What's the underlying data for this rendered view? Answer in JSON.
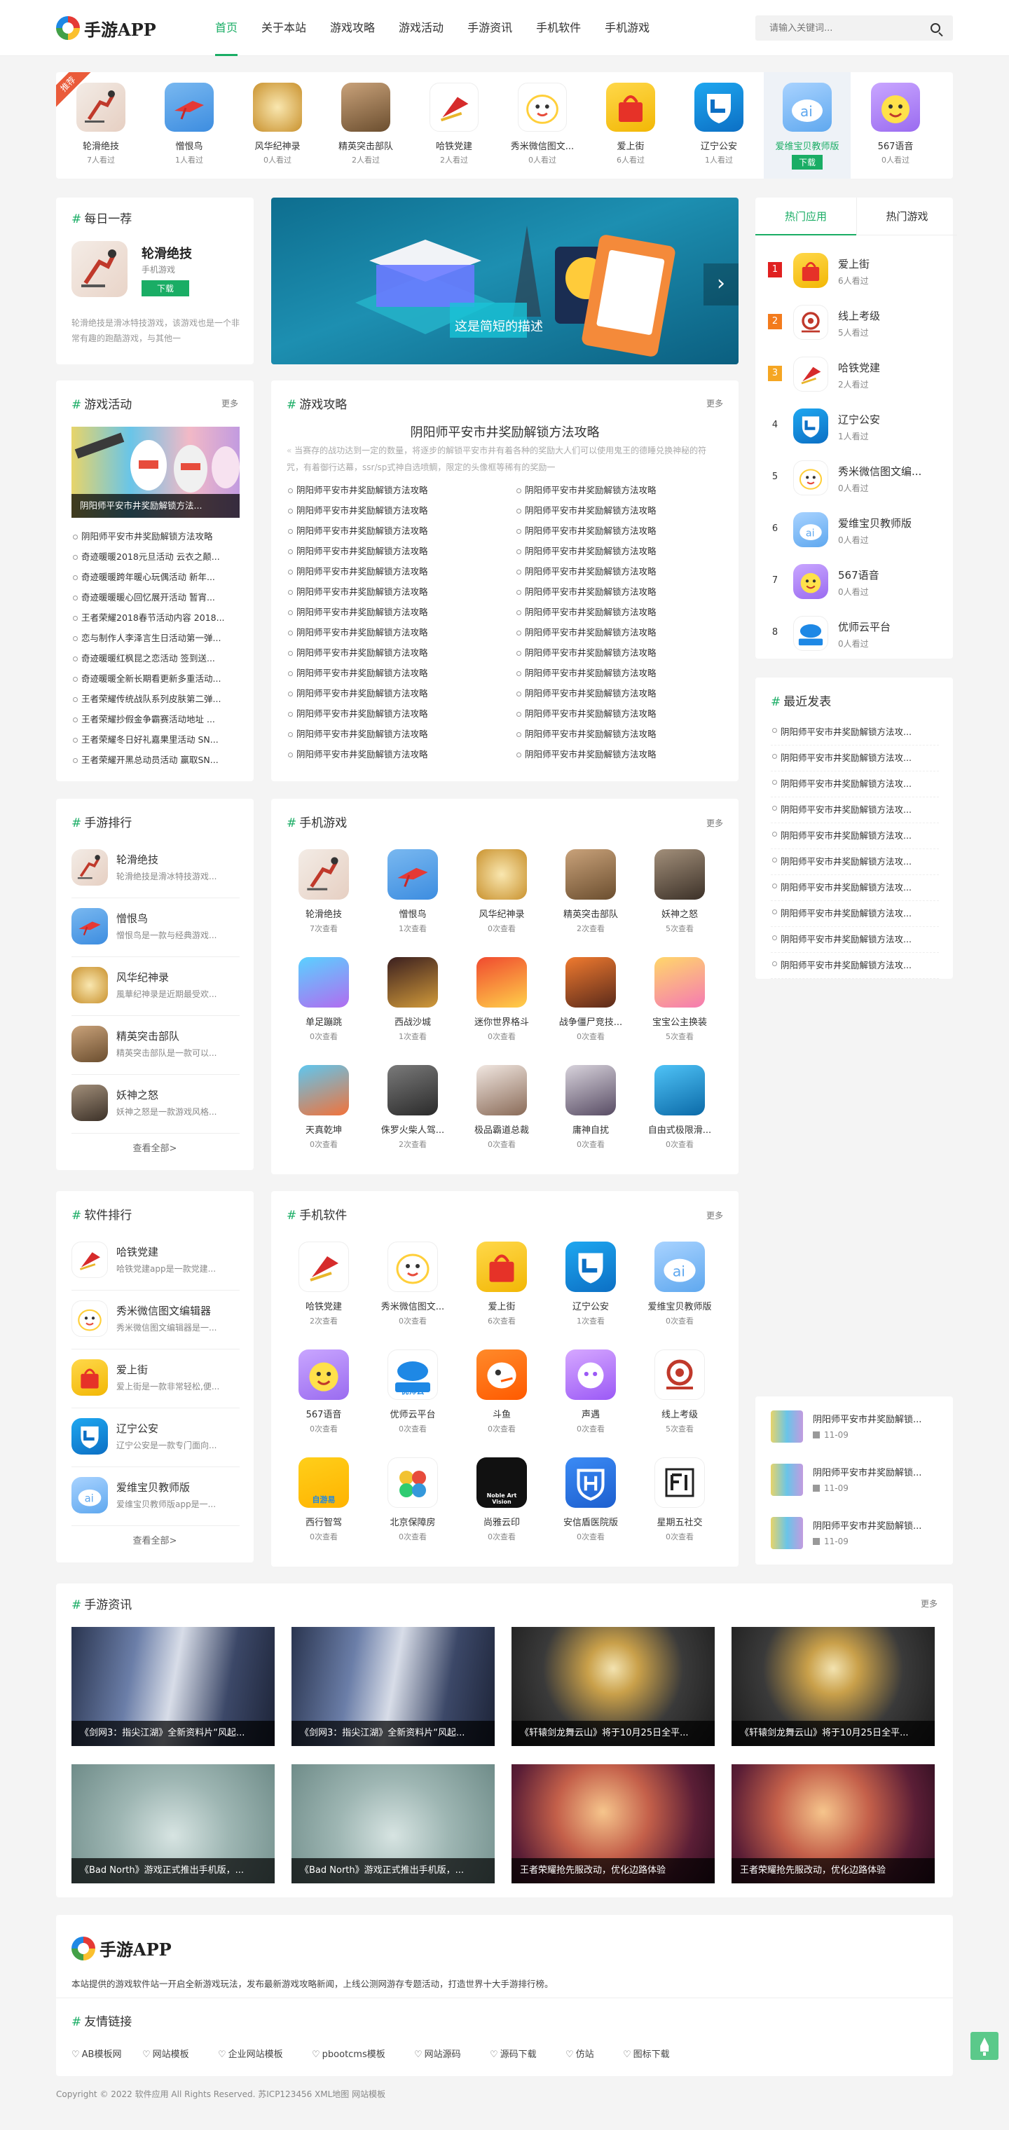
{
  "header": {
    "logo_text": "手游APP",
    "nav": [
      "首页",
      "关于本站",
      "游戏攻略",
      "游戏活动",
      "手游资讯",
      "手机软件",
      "手机游戏"
    ],
    "search_placeholder": "请输入关键词..."
  },
  "hot_strip": {
    "badge": "推荐",
    "items": [
      {
        "name": "轮滑绝技",
        "views": "7人看过",
        "icon": "skater-icon"
      },
      {
        "name": "憎恨鸟",
        "views": "1人看过",
        "icon": "bird-icon"
      },
      {
        "name": "风华纪神录",
        "views": "0人看过",
        "icon": "shenlu-icon"
      },
      {
        "name": "精英突击部队",
        "views": "2人看过",
        "icon": "soldier-icon"
      },
      {
        "name": "哈铁党建",
        "views": "2人看过",
        "icon": "party-flag-icon"
      },
      {
        "name": "秀米微信图文...",
        "views": "0人看过",
        "icon": "xiumi-icon"
      },
      {
        "name": "爱上街",
        "views": "6人看过",
        "icon": "shop-bag-icon"
      },
      {
        "name": "辽宁公安",
        "views": "1人看过",
        "icon": "police-icon"
      },
      {
        "name": "爱维宝贝教师版",
        "views": "",
        "icon": "ai-cloud-icon",
        "download": "下载"
      },
      {
        "name": "567语音",
        "views": "0人看过",
        "icon": "voice-face-icon"
      }
    ]
  },
  "daily": {
    "title": "每日一荐",
    "name": "轮滑绝技",
    "category": "手机游戏",
    "download": "下载",
    "desc": "轮滑绝技是滑冰特技游戏，该游戏也是一个非常有趣的跑酷游戏，与其他一"
  },
  "banner": {
    "caption": "这是简短的描述"
  },
  "activities": {
    "title": "游戏活动",
    "more": "更多",
    "image_caption": "阴阳师平安市井奖励解锁方法...",
    "items": [
      "阴阳师平安市井奖励解锁方法攻略",
      "奇迹暖暖2018元旦活动 云衣之颠...",
      "奇迹暖暖跨年暖心玩偶活动 新年...",
      "奇迹暖暖暖心回忆展开活动 暂宵...",
      "王者荣耀2018春节活动内容 2018...",
      "恋与制作人李泽言生日活动第一弹...",
      "奇迹暖暖红枫昆之恋活动 签到送...",
      "奇迹暖暖全新长期看更新多重活动...",
      "王者荣耀传统战队系列皮肤第二弹...",
      "王者荣耀抄假金争霸赛活动地址 ...",
      "王者荣耀冬日好礼嘉果里活动 SN...",
      "王者荣耀开黑总动员活动 赢取SN..."
    ]
  },
  "guides": {
    "title": "游戏攻略",
    "more": "更多",
    "headline": "阴阳师平安市井奖励解锁方法攻略",
    "summary": "当赛存的战功达到一定的数量，将逐步的解锁平安市井有着各种的奖励大人们可以使用鬼王的德睡兑换神秘的符咒，有着御行达幕，ssr/sp式神自选喷鲷，限定的头像框等稀有的奖励一",
    "items": [
      "阴阳师平安市井奖励解锁方法攻略",
      "阴阳师平安市井奖励解锁方法攻略",
      "阴阳师平安市井奖励解锁方法攻略",
      "阴阳师平安市井奖励解锁方法攻略",
      "阴阳师平安市井奖励解锁方法攻略",
      "阴阳师平安市井奖励解锁方法攻略",
      "阴阳师平安市井奖励解锁方法攻略",
      "阴阳师平安市井奖励解锁方法攻略",
      "阴阳师平安市井奖励解锁方法攻略",
      "阴阳师平安市井奖励解锁方法攻略",
      "阴阳师平安市井奖励解锁方法攻略",
      "阴阳师平安市井奖励解锁方法攻略",
      "阴阳师平安市井奖励解锁方法攻略",
      "阴阳师平安市井奖励解锁方法攻略",
      "阴阳师平安市井奖励解锁方法攻略",
      "阴阳师平安市井奖励解锁方法攻略",
      "阴阳师平安市井奖励解锁方法攻略",
      "阴阳师平安市井奖励解锁方法攻略",
      "阴阳师平安市井奖励解锁方法攻略",
      "阴阳师平安市井奖励解锁方法攻略",
      "阴阳师平安市井奖励解锁方法攻略",
      "阴阳师平安市井奖励解锁方法攻略",
      "阴阳师平安市井奖励解锁方法攻略",
      "阴阳师平安市井奖励解锁方法攻略",
      "阴阳师平安市井奖励解锁方法攻略",
      "阴阳师平安市井奖励解锁方法攻略",
      "阴阳师平安市井奖励解锁方法攻略",
      "阴阳师平安市井奖励解锁方法攻略"
    ]
  },
  "hot_tabs": {
    "tabs": [
      "热门应用",
      "热门游戏"
    ],
    "items": [
      {
        "rank": "1",
        "name": "爱上街",
        "views": "6人看过",
        "icon": "shop-bag-icon"
      },
      {
        "rank": "2",
        "name": "线上考级",
        "views": "5人看过",
        "icon": "exam-seal-icon"
      },
      {
        "rank": "3",
        "name": "哈铁党建",
        "views": "2人看过",
        "icon": "party-flag-icon"
      },
      {
        "rank": "4",
        "name": "辽宁公安",
        "views": "1人看过",
        "icon": "police-icon"
      },
      {
        "rank": "5",
        "name": "秀米微信图文编...",
        "views": "0人看过",
        "icon": "xiumi-icon"
      },
      {
        "rank": "6",
        "name": "爱维宝贝教师版",
        "views": "0人看过",
        "icon": "ai-cloud-icon"
      },
      {
        "rank": "7",
        "name": "567语音",
        "views": "0人看过",
        "icon": "voice-face-icon"
      },
      {
        "rank": "8",
        "name": "优师云平台",
        "views": "0人看过",
        "icon": "cloud-teacher-icon"
      }
    ]
  },
  "recent": {
    "title": "最近发表",
    "items": [
      "阴阳师平安市井奖励解锁方法攻...",
      "阴阳师平安市井奖励解锁方法攻...",
      "阴阳师平安市井奖励解锁方法攻...",
      "阴阳师平安市井奖励解锁方法攻...",
      "阴阳师平安市井奖励解锁方法攻...",
      "阴阳师平安市井奖励解锁方法攻...",
      "阴阳师平安市井奖励解锁方法攻...",
      "阴阳师平安市井奖励解锁方法攻...",
      "阴阳师平安市井奖励解锁方法攻...",
      "阴阳师平安市井奖励解锁方法攻..."
    ]
  },
  "game_rank": {
    "title": "手游排行",
    "view_all": "查看全部>",
    "items": [
      {
        "name": "轮滑绝技",
        "desc": "轮滑绝技是滑冰特技游戏...",
        "icon": "skater-icon"
      },
      {
        "name": "憎恨鸟",
        "desc": "憎恨鸟是一款与经典游戏...",
        "icon": "bird-icon"
      },
      {
        "name": "风华纪神录",
        "desc": "風華纪神录是近期最受欢...",
        "icon": "shenlu-icon"
      },
      {
        "name": "精英突击部队",
        "desc": "精英突击部队是一款可以...",
        "icon": "soldier-icon"
      },
      {
        "name": "妖神之怒",
        "desc": "妖神之怒是一款游戏风格...",
        "icon": "yaoshen-icon"
      }
    ]
  },
  "mobile_games": {
    "title": "手机游戏",
    "more": "更多",
    "items": [
      {
        "name": "轮滑绝技",
        "views": "7次查看",
        "icon": "skater-icon"
      },
      {
        "name": "憎恨鸟",
        "views": "1次查看",
        "icon": "bird-icon"
      },
      {
        "name": "风华纪神录",
        "views": "0次查看",
        "icon": "shenlu-icon"
      },
      {
        "name": "精英突击部队",
        "views": "2次查看",
        "icon": "soldier-icon"
      },
      {
        "name": "妖神之怒",
        "views": "5次查看",
        "icon": "yaoshen-icon"
      },
      {
        "name": "单足蹦跳",
        "views": "0次查看",
        "icon": "hop-icon"
      },
      {
        "name": "西战沙城",
        "views": "1次查看",
        "icon": "warrior-icon"
      },
      {
        "name": "迷你世界格斗",
        "views": "0次查看",
        "icon": "mini-world-icon"
      },
      {
        "name": "战争僵尸竞技...",
        "views": "0次查看",
        "icon": "zombie-icon"
      },
      {
        "name": "宝宝公主换装",
        "views": "5次查看",
        "icon": "princess-icon"
      },
      {
        "name": "天真乾坤",
        "views": "0次查看",
        "icon": "qiankun-icon"
      },
      {
        "name": "侏罗火柴人驾...",
        "views": "2次查看",
        "icon": "stickman-car-icon"
      },
      {
        "name": "极品霸道总裁",
        "views": "0次查看",
        "icon": "ceo-icon"
      },
      {
        "name": "庸神自扰",
        "views": "0次查看",
        "icon": "goddess-icon"
      },
      {
        "name": "自由式极限滑...",
        "views": "0次查看",
        "icon": "skateboard-icon"
      }
    ]
  },
  "soft_rank": {
    "title": "软件排行",
    "view_all": "查看全部>",
    "items": [
      {
        "name": "哈铁党建",
        "desc": "哈铁党建app是一款党建...",
        "icon": "party-flag-icon"
      },
      {
        "name": "秀米微信图文编辑器",
        "desc": "秀米微信图文编辑器是一...",
        "icon": "xiumi-icon"
      },
      {
        "name": "爱上街",
        "desc": "爱上街是一款非常轻松,便...",
        "icon": "shop-bag-icon"
      },
      {
        "name": "辽宁公安",
        "desc": "辽宁公安是一款专门面向...",
        "icon": "police-icon"
      },
      {
        "name": "爱维宝贝教师版",
        "desc": "爱维宝贝教师版app是一...",
        "icon": "ai-cloud-icon"
      }
    ]
  },
  "mobile_soft": {
    "title": "手机软件",
    "more": "更多",
    "items": [
      {
        "name": "哈铁党建",
        "views": "2次查看",
        "icon": "party-flag-icon"
      },
      {
        "name": "秀米微信图文...",
        "views": "0次查看",
        "icon": "xiumi-icon"
      },
      {
        "name": "爱上街",
        "views": "6次查看",
        "icon": "shop-bag-icon"
      },
      {
        "name": "辽宁公安",
        "views": "1次查看",
        "icon": "police-icon"
      },
      {
        "name": "爱维宝贝教师版",
        "views": "0次查看",
        "icon": "ai-cloud-icon"
      },
      {
        "name": "567语音",
        "views": "0次查看",
        "icon": "voice-face-icon"
      },
      {
        "name": "优师云平台",
        "views": "0次查看",
        "icon": "cloud-teacher-icon",
        "label": "优师云"
      },
      {
        "name": "斗鱼",
        "views": "0次查看",
        "icon": "douyu-icon"
      },
      {
        "name": "声遇",
        "views": "0次查看",
        "icon": "shengyu-icon"
      },
      {
        "name": "线上考级",
        "views": "5次查看",
        "icon": "exam-seal-icon"
      },
      {
        "name": "西行智驾",
        "views": "0次查看",
        "icon": "xixing-icon",
        "label": "自游易"
      },
      {
        "name": "北京保障房",
        "views": "0次查看",
        "icon": "housing-icon"
      },
      {
        "name": "尚雅云印",
        "views": "0次查看",
        "icon": "shangya-icon",
        "label": "Noble Art Vision"
      },
      {
        "name": "安信盾医院版",
        "views": "0次查看",
        "icon": "anxindun-icon"
      },
      {
        "name": "星期五社交",
        "views": "0次查看",
        "icon": "friday-icon"
      }
    ]
  },
  "side_articles": [
    {
      "title": "阴阳师平安市井奖励解锁...",
      "date": "11-09"
    },
    {
      "title": "阴阳师平安市井奖励解锁...",
      "date": "11-09"
    },
    {
      "title": "阴阳师平安市井奖励解锁...",
      "date": "11-09"
    }
  ],
  "news": {
    "title": "手游资讯",
    "more": "更多",
    "items": [
      {
        "caption": "《剑网3：指尖江湖》全新资料片“风起...",
        "theme": "jianwang"
      },
      {
        "caption": "《剑网3：指尖江湖》全新资料片“风起...",
        "theme": "jianwang"
      },
      {
        "caption": "《轩辕剑龙舞云山》将于10月25日全平...",
        "theme": "xuanyuan"
      },
      {
        "caption": "《轩辕剑龙舞云山》将于10月25日全平...",
        "theme": "xuanyuan"
      },
      {
        "caption": "《Bad North》游戏正式推出手机版，...",
        "theme": "badnorth"
      },
      {
        "caption": "《Bad North》游戏正式推出手机版，...",
        "theme": "badnorth"
      },
      {
        "caption": "王者荣耀抢先服改动，优化边路体验",
        "theme": "wangzhe"
      },
      {
        "caption": "王者荣耀抢先服改动，优化边路体验",
        "theme": "wangzhe"
      }
    ]
  },
  "footer": {
    "logo_text": "手游APP",
    "desc": "本站提供的游戏软件站一开启全新游戏玩法，发布最新游戏攻略新闻，上线公测网游存专题活动，打造世界十大手游排行榜。",
    "links_title": "友情链接",
    "links": [
      "AB模板网",
      "网站模板",
      "企业网站模板",
      "pbootcms模板",
      "网站源码",
      "源码下载",
      "仿站",
      "图标下载"
    ],
    "copyright": "Copyright © 2022 软件应用 All Rights Reserved. 苏ICP123456 XML地图 网站模板"
  }
}
